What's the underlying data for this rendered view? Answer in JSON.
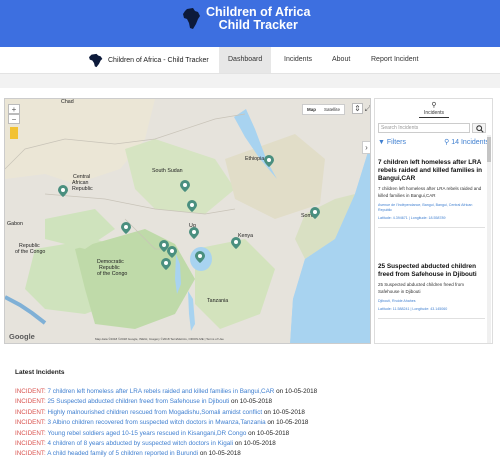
{
  "banner": {
    "title_line1": "Children of Africa",
    "title_line2": "Child Tracker"
  },
  "nav": {
    "brand": "Children of Africa - Child Tracker",
    "items": [
      {
        "label": "Dashboard",
        "active": true
      },
      {
        "label": "Incidents",
        "active": false
      },
      {
        "label": "About",
        "active": false
      },
      {
        "label": "Report Incident",
        "active": false
      }
    ]
  },
  "map": {
    "type_map": "Map",
    "type_satellite": "Satellite",
    "labels": {
      "chad": "Chad",
      "south_sudan": "South Sudan",
      "car1": "Central",
      "car2": "African",
      "car3": "Republic",
      "ethiopia": "Ethiopia",
      "uganda": "Ug",
      "kenya": "Kenya",
      "somalia": "Somali",
      "roc1": "Republic",
      "roc2": "of the Congo",
      "drc1": "Democratic",
      "drc2": "Republic",
      "drc3": "of the Congo",
      "tanzania": "Tanzania",
      "gabon": "Gabon"
    },
    "footer": "Map data ©2018 ©2018 Google, INEGI, Imagery ©2018 TerraMetrics, ORION-ME | Terms of Use",
    "google": "Google",
    "pin_color": "#4a8f7f"
  },
  "panel": {
    "tab_label": "Incidents",
    "search_placeholder": "Search Incidents",
    "filters_label": "Filters",
    "incidents_count": "14 Incidents",
    "cards": [
      {
        "title": "7 children left homeless after LRA rebels raided and killed families in Bangui,CAR",
        "desc": "7 children left homeless after LRA rebels raided and killed families in Bangui,CAR",
        "location": "Avenue de l'Indépendance, Bangui, Bangui, Central African Republic",
        "coords": "Latitude: 4.394671 | Longitude: 18.558789"
      },
      {
        "title": "25 Suspected abducted children freed from Safehouse in Djibouti",
        "desc": "25 Suspected abducted children freed from Safehouse in Djibouti",
        "location": "Djibouti, Rruide Ahahes",
        "coords": "Latitude: 11.588241 | Longitude: 43.145060"
      }
    ]
  },
  "latest": {
    "heading": "Latest Incidents",
    "label": "INCIDENT:",
    "on": "on",
    "items": [
      {
        "title": "7 children left homeless after LRA rebels raided and killed families in Bangui,CAR",
        "date": "10-05-2018"
      },
      {
        "title": "25 Suspected abducted children freed from Safehouse in Djibouti",
        "date": "10-05-2018"
      },
      {
        "title": "Highly malnourished children rescued from Mogadishu,Somali amidst conflict",
        "date": "10-05-2018"
      },
      {
        "title": "3 Albino children recovered from suspected witch doctors in Mwanza,Tanzania",
        "date": "10-05-2018"
      },
      {
        "title": "Young rebel soldiers aged 10-15 years rescued in Kisangani,DR Congo",
        "date": "10-05-2018"
      },
      {
        "title": "4 children of 8 years abducted by suspected witch doctors in Kigali",
        "date": "10-05-2018"
      },
      {
        "title": "A child headed family of 5 children reported in Burundi",
        "date": "10-05-2018"
      }
    ]
  }
}
